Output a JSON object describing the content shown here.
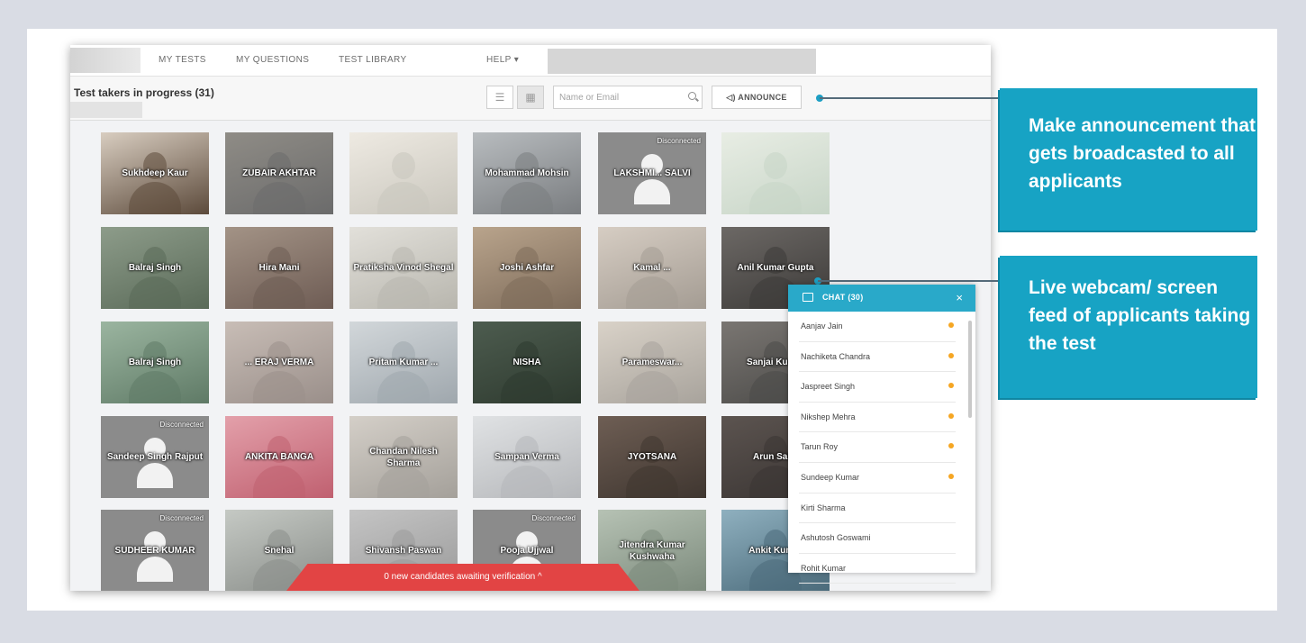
{
  "nav": {
    "items": [
      "MY TESTS",
      "MY QUESTIONS",
      "TEST LIBRARY",
      "HELP ▾"
    ]
  },
  "toolbar": {
    "title": "Test takers in progress (31)",
    "list_view_icon": "☰",
    "grid_view_icon": "▦",
    "search_placeholder": "Name or Email",
    "announce_label": "◁) ANNOUNCE"
  },
  "tiles": [
    {
      "name": "Sukhdeep Kaur",
      "disconnected": false
    },
    {
      "name": "ZUBAIR AKHTAR",
      "disconnected": false
    },
    {
      "name": "",
      "disconnected": false
    },
    {
      "name": "Mohammad Mohsin",
      "disconnected": false
    },
    {
      "name": "LAKSHMI... SALVI",
      "disconnected": true
    },
    {
      "name": "",
      "disconnected": false
    },
    {
      "name": "Balraj Singh",
      "disconnected": false
    },
    {
      "name": "Hira Mani",
      "disconnected": false
    },
    {
      "name": "Pratiksha Vinod Shegal",
      "disconnected": false
    },
    {
      "name": "Joshi Ashfar",
      "disconnected": false
    },
    {
      "name": "Kamal ...",
      "disconnected": false
    },
    {
      "name": "Anil Kumar Gupta",
      "disconnected": false
    },
    {
      "name": "Balraj Singh",
      "disconnected": false
    },
    {
      "name": "... ERAJ VERMA",
      "disconnected": false
    },
    {
      "name": "Pritam Kumar ...",
      "disconnected": false
    },
    {
      "name": "NISHA",
      "disconnected": false
    },
    {
      "name": "Parameswar...",
      "disconnected": false
    },
    {
      "name": "Sanjai Kumar",
      "disconnected": false
    },
    {
      "name": "Sandeep Singh Rajput",
      "disconnected": true
    },
    {
      "name": "ANKITA BANGA",
      "disconnected": false
    },
    {
      "name": "Chandan Nilesh Sharma",
      "disconnected": false
    },
    {
      "name": "Sampan Verma",
      "disconnected": false
    },
    {
      "name": "JYOTSANA",
      "disconnected": false
    },
    {
      "name": "Arun Saini",
      "disconnected": false
    },
    {
      "name": "SUDHEER KUMAR",
      "disconnected": true
    },
    {
      "name": "Snehal",
      "disconnected": false
    },
    {
      "name": "Shivansh Paswan",
      "disconnected": false
    },
    {
      "name": "Pooja Ujjwal",
      "disconnected": true
    },
    {
      "name": "Jitendra Kumar Kushwaha",
      "disconnected": false
    },
    {
      "name": "Ankit Kumar",
      "disconnected": false
    }
  ],
  "tile_disconnected_label": "Disconnected",
  "verify_bar": "0 new candidates awaiting verification ^",
  "chat": {
    "title": "CHAT (30)",
    "close": "×",
    "items": [
      {
        "name": "Aanjav Jain",
        "unread": true
      },
      {
        "name": "Nachiketa Chandra",
        "unread": true
      },
      {
        "name": "Jaspreet Singh",
        "unread": true
      },
      {
        "name": "Nikshep Mehra",
        "unread": true
      },
      {
        "name": "Tarun Roy",
        "unread": true
      },
      {
        "name": "Sundeep Kumar",
        "unread": true
      },
      {
        "name": "Kirti Sharma",
        "unread": false
      },
      {
        "name": "Ashutosh Goswami",
        "unread": false
      },
      {
        "name": "Rohit Kumar",
        "unread": false
      }
    ]
  },
  "callouts": {
    "announce": "Make announcement that gets broadcasted to all applicants",
    "feed": "Live webcam/ screen feed of applicants taking the test"
  },
  "colors": {
    "accent": "#17a3c4",
    "chat_header": "#29a9c9",
    "verify_bar": "#e24444",
    "unread_dot": "#f5a623"
  }
}
